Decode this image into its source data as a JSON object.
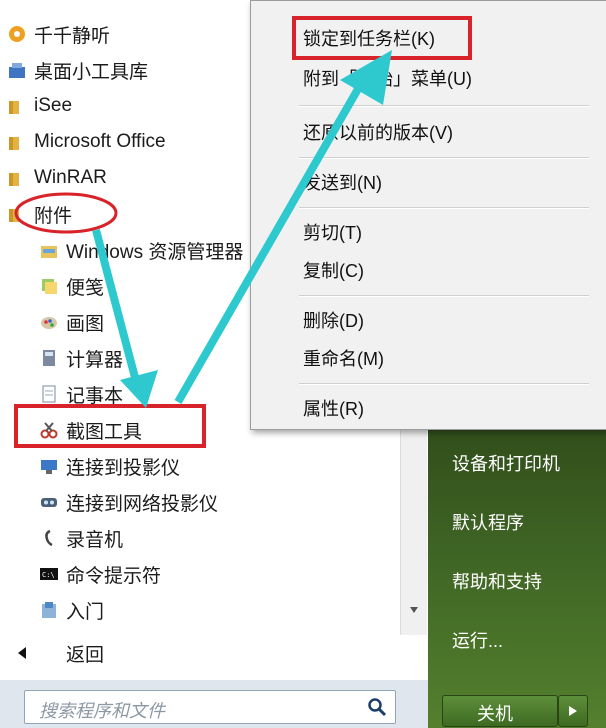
{
  "programs": [
    {
      "label": "千千静听",
      "icon": "player-icon"
    },
    {
      "label": "桌面小工具库",
      "icon": "gadgets-icon"
    },
    {
      "label": "iSee",
      "icon": "folder-icon"
    },
    {
      "label": "Microsoft Office",
      "icon": "folder-icon"
    },
    {
      "label": "WinRAR",
      "icon": "folder-icon"
    },
    {
      "label": "附件",
      "icon": "folder-icon"
    }
  ],
  "accessories": [
    {
      "label": "Windows 资源管理器",
      "icon": "explorer-icon"
    },
    {
      "label": "便笺",
      "icon": "sticky-notes-icon"
    },
    {
      "label": "画图",
      "icon": "paint-icon"
    },
    {
      "label": "计算器",
      "icon": "calculator-icon"
    },
    {
      "label": "记事本",
      "icon": "notepad-icon"
    },
    {
      "label": "截图工具",
      "icon": "scissors-icon"
    },
    {
      "label": "连接到投影仪",
      "icon": "projector-icon"
    },
    {
      "label": "连接到网络投影仪",
      "icon": "network-projector-icon"
    },
    {
      "label": "录音机",
      "icon": "microphone-icon"
    },
    {
      "label": "命令提示符",
      "icon": "cmd-icon"
    },
    {
      "label": "入门",
      "icon": "getting-started-icon"
    }
  ],
  "back": {
    "label": "返回",
    "icon": "left-arrow-icon"
  },
  "search": {
    "placeholder": "搜索程序和文件",
    "icon": "search-icon"
  },
  "right_panel": {
    "items": [
      "设备和打印机",
      "默认程序",
      "帮助和支持",
      "运行..."
    ],
    "shutdown": "关机"
  },
  "context_menu": {
    "items": [
      "锁定到任务栏(K)",
      "附到「开始」菜单(U)",
      "还原以前的版本(V)",
      "发送到(N)",
      "剪切(T)",
      "复制(C)",
      "删除(D)",
      "重命名(M)",
      "属性(R)"
    ]
  },
  "colors": {
    "highlight": "#d9232a",
    "arrow": "#2ec9cf",
    "start_green": "#3e6424"
  }
}
